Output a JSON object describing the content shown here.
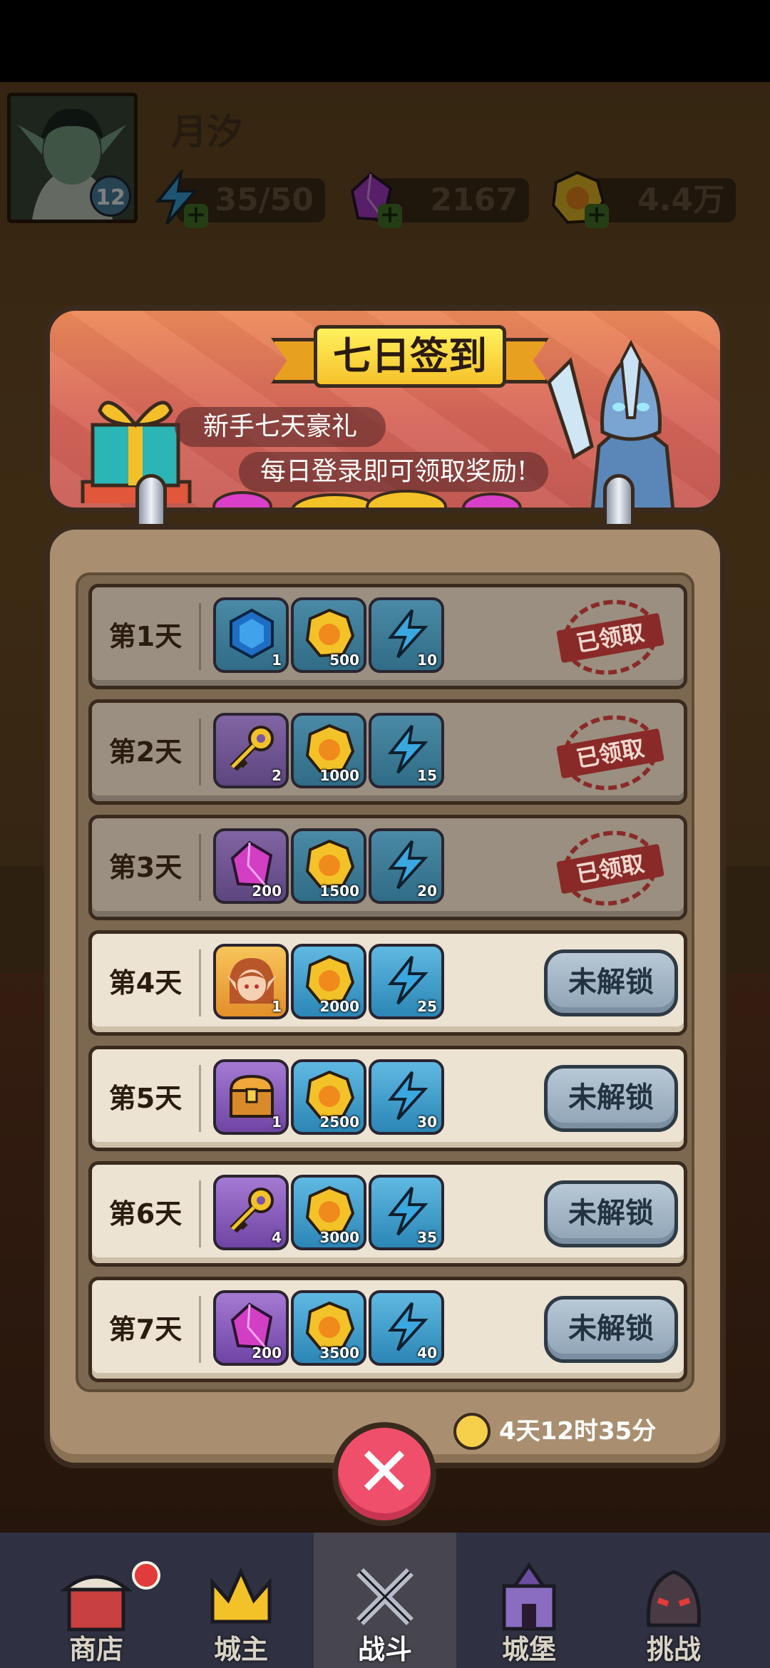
{
  "player": {
    "name": "月汐",
    "level": "12",
    "energy": "35/50",
    "gems": "2167",
    "gold": "4.4万"
  },
  "banner": {
    "title": "七日签到",
    "subtitle": "新手七天豪礼",
    "description": "每日登录即可领取奖励!"
  },
  "days": [
    {
      "label": "第1天",
      "status": "已领取",
      "items": [
        {
          "icon": "blue-gem-icon",
          "qty": "1"
        },
        {
          "icon": "gold-coin-icon",
          "qty": "500"
        },
        {
          "icon": "energy-bolt-icon",
          "qty": "10"
        }
      ]
    },
    {
      "label": "第2天",
      "status": "已领取",
      "items": [
        {
          "icon": "gold-key-icon",
          "qty": "2"
        },
        {
          "icon": "gold-coin-icon",
          "qty": "1000"
        },
        {
          "icon": "energy-bolt-icon",
          "qty": "15"
        }
      ]
    },
    {
      "label": "第3天",
      "status": "已领取",
      "items": [
        {
          "icon": "purple-crystal-icon",
          "qty": "200"
        },
        {
          "icon": "gold-coin-icon",
          "qty": "1500"
        },
        {
          "icon": "energy-bolt-icon",
          "qty": "20"
        }
      ]
    },
    {
      "label": "第4天",
      "status": "未解锁",
      "items": [
        {
          "icon": "hero-portrait-icon",
          "qty": "1"
        },
        {
          "icon": "gold-coin-icon",
          "qty": "2000"
        },
        {
          "icon": "energy-bolt-icon",
          "qty": "25"
        }
      ]
    },
    {
      "label": "第5天",
      "status": "未解锁",
      "items": [
        {
          "icon": "treasure-chest-icon",
          "qty": "1"
        },
        {
          "icon": "gold-coin-icon",
          "qty": "2500"
        },
        {
          "icon": "energy-bolt-icon",
          "qty": "30"
        }
      ]
    },
    {
      "label": "第6天",
      "status": "未解锁",
      "items": [
        {
          "icon": "gold-key-icon",
          "qty": "4"
        },
        {
          "icon": "gold-coin-icon",
          "qty": "3000"
        },
        {
          "icon": "energy-bolt-icon",
          "qty": "35"
        }
      ]
    },
    {
      "label": "第7天",
      "status": "未解锁",
      "items": [
        {
          "icon": "purple-crystal-icon",
          "qty": "200"
        },
        {
          "icon": "gold-coin-icon",
          "qty": "3500"
        },
        {
          "icon": "energy-bolt-icon",
          "qty": "40"
        }
      ]
    }
  ],
  "timer": "4天12时35分",
  "close_icon": "close-icon",
  "nav": [
    {
      "label": "商店",
      "icon": "shop-icon"
    },
    {
      "label": "城主",
      "icon": "crown-icon"
    },
    {
      "label": "战斗",
      "icon": "crossed-swords-icon",
      "active": true
    },
    {
      "label": "城堡",
      "icon": "castle-icon"
    },
    {
      "label": "挑战",
      "icon": "demon-helmet-icon"
    }
  ]
}
